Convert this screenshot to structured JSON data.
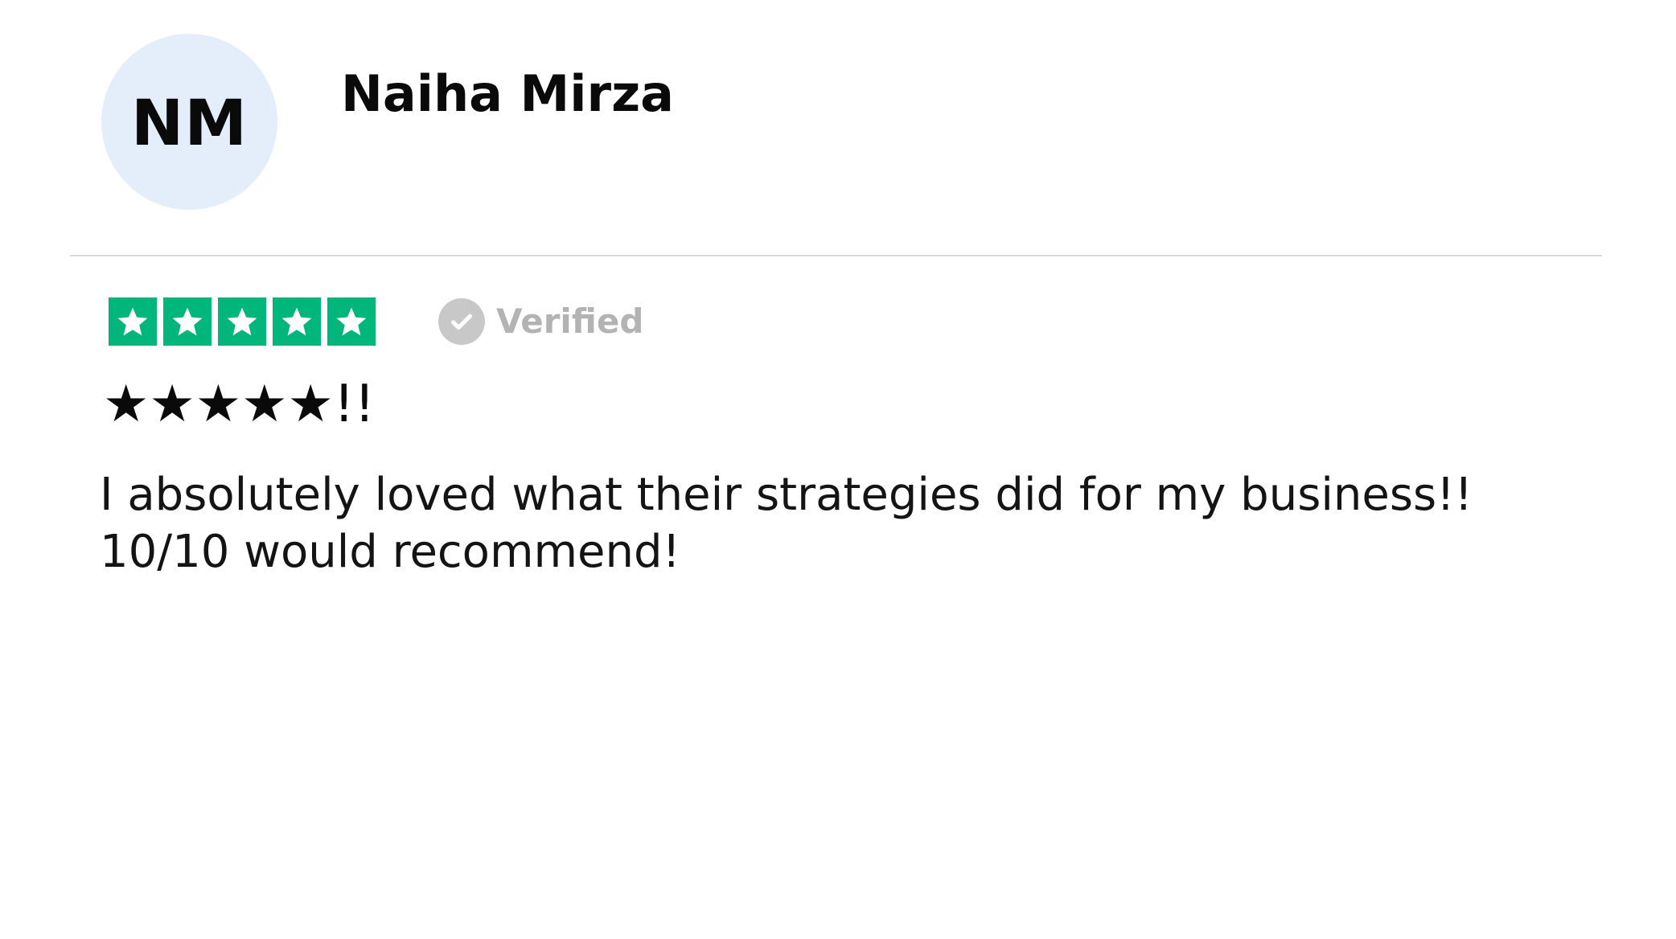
{
  "reviewer": {
    "initials": "NM",
    "name": "Naiha Mirza"
  },
  "rating": {
    "value": 5,
    "max": 5,
    "color": "#00b67a"
  },
  "verified": {
    "label": "Verified",
    "icon": "check-circle-icon"
  },
  "review": {
    "title": "★★★★★!!",
    "body": "I absolutely loved what their strategies did for my business!! 10/10 would recommend!"
  }
}
